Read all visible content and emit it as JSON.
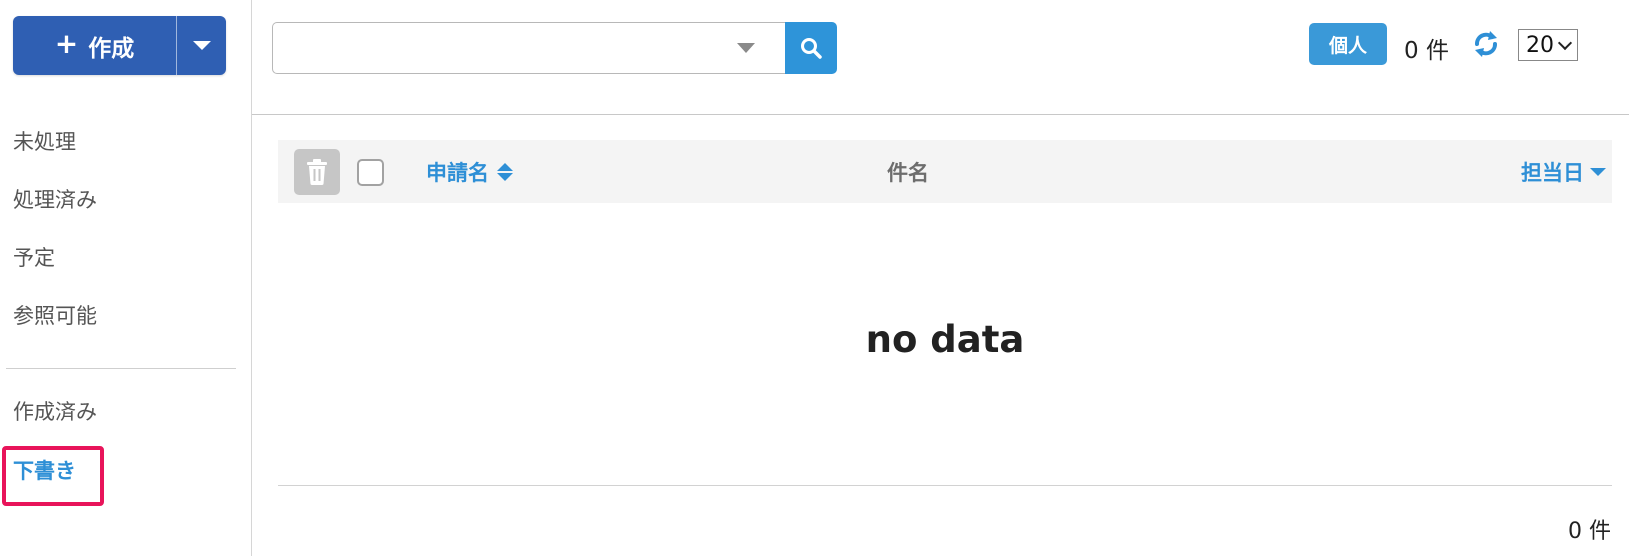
{
  "sidebar": {
    "create_label": "作成",
    "items": [
      {
        "label": "未処理"
      },
      {
        "label": "処理済み"
      },
      {
        "label": "予定"
      },
      {
        "label": "参照可能"
      },
      {
        "label": "作成済み"
      },
      {
        "label": "下書き"
      }
    ],
    "active_index": 5
  },
  "toolbar": {
    "search_value": "",
    "scope_badge": "個人",
    "count_text": "0 件",
    "per_page": "20"
  },
  "table": {
    "columns": [
      "申請名",
      "件名",
      "担当日"
    ],
    "empty_message": "no data",
    "footer_count": "0 件"
  },
  "colors": {
    "primary": "#2f5fb3",
    "accent": "#2e8fd6",
    "highlight_border": "#e8145a"
  },
  "icons": {
    "create": "plus-icon",
    "dropdown": "caret-down-icon",
    "search": "search-icon",
    "refresh": "refresh-icon",
    "delete": "trash-icon",
    "sort_both": "sort-icon",
    "sort_desc": "sort-down-icon"
  }
}
